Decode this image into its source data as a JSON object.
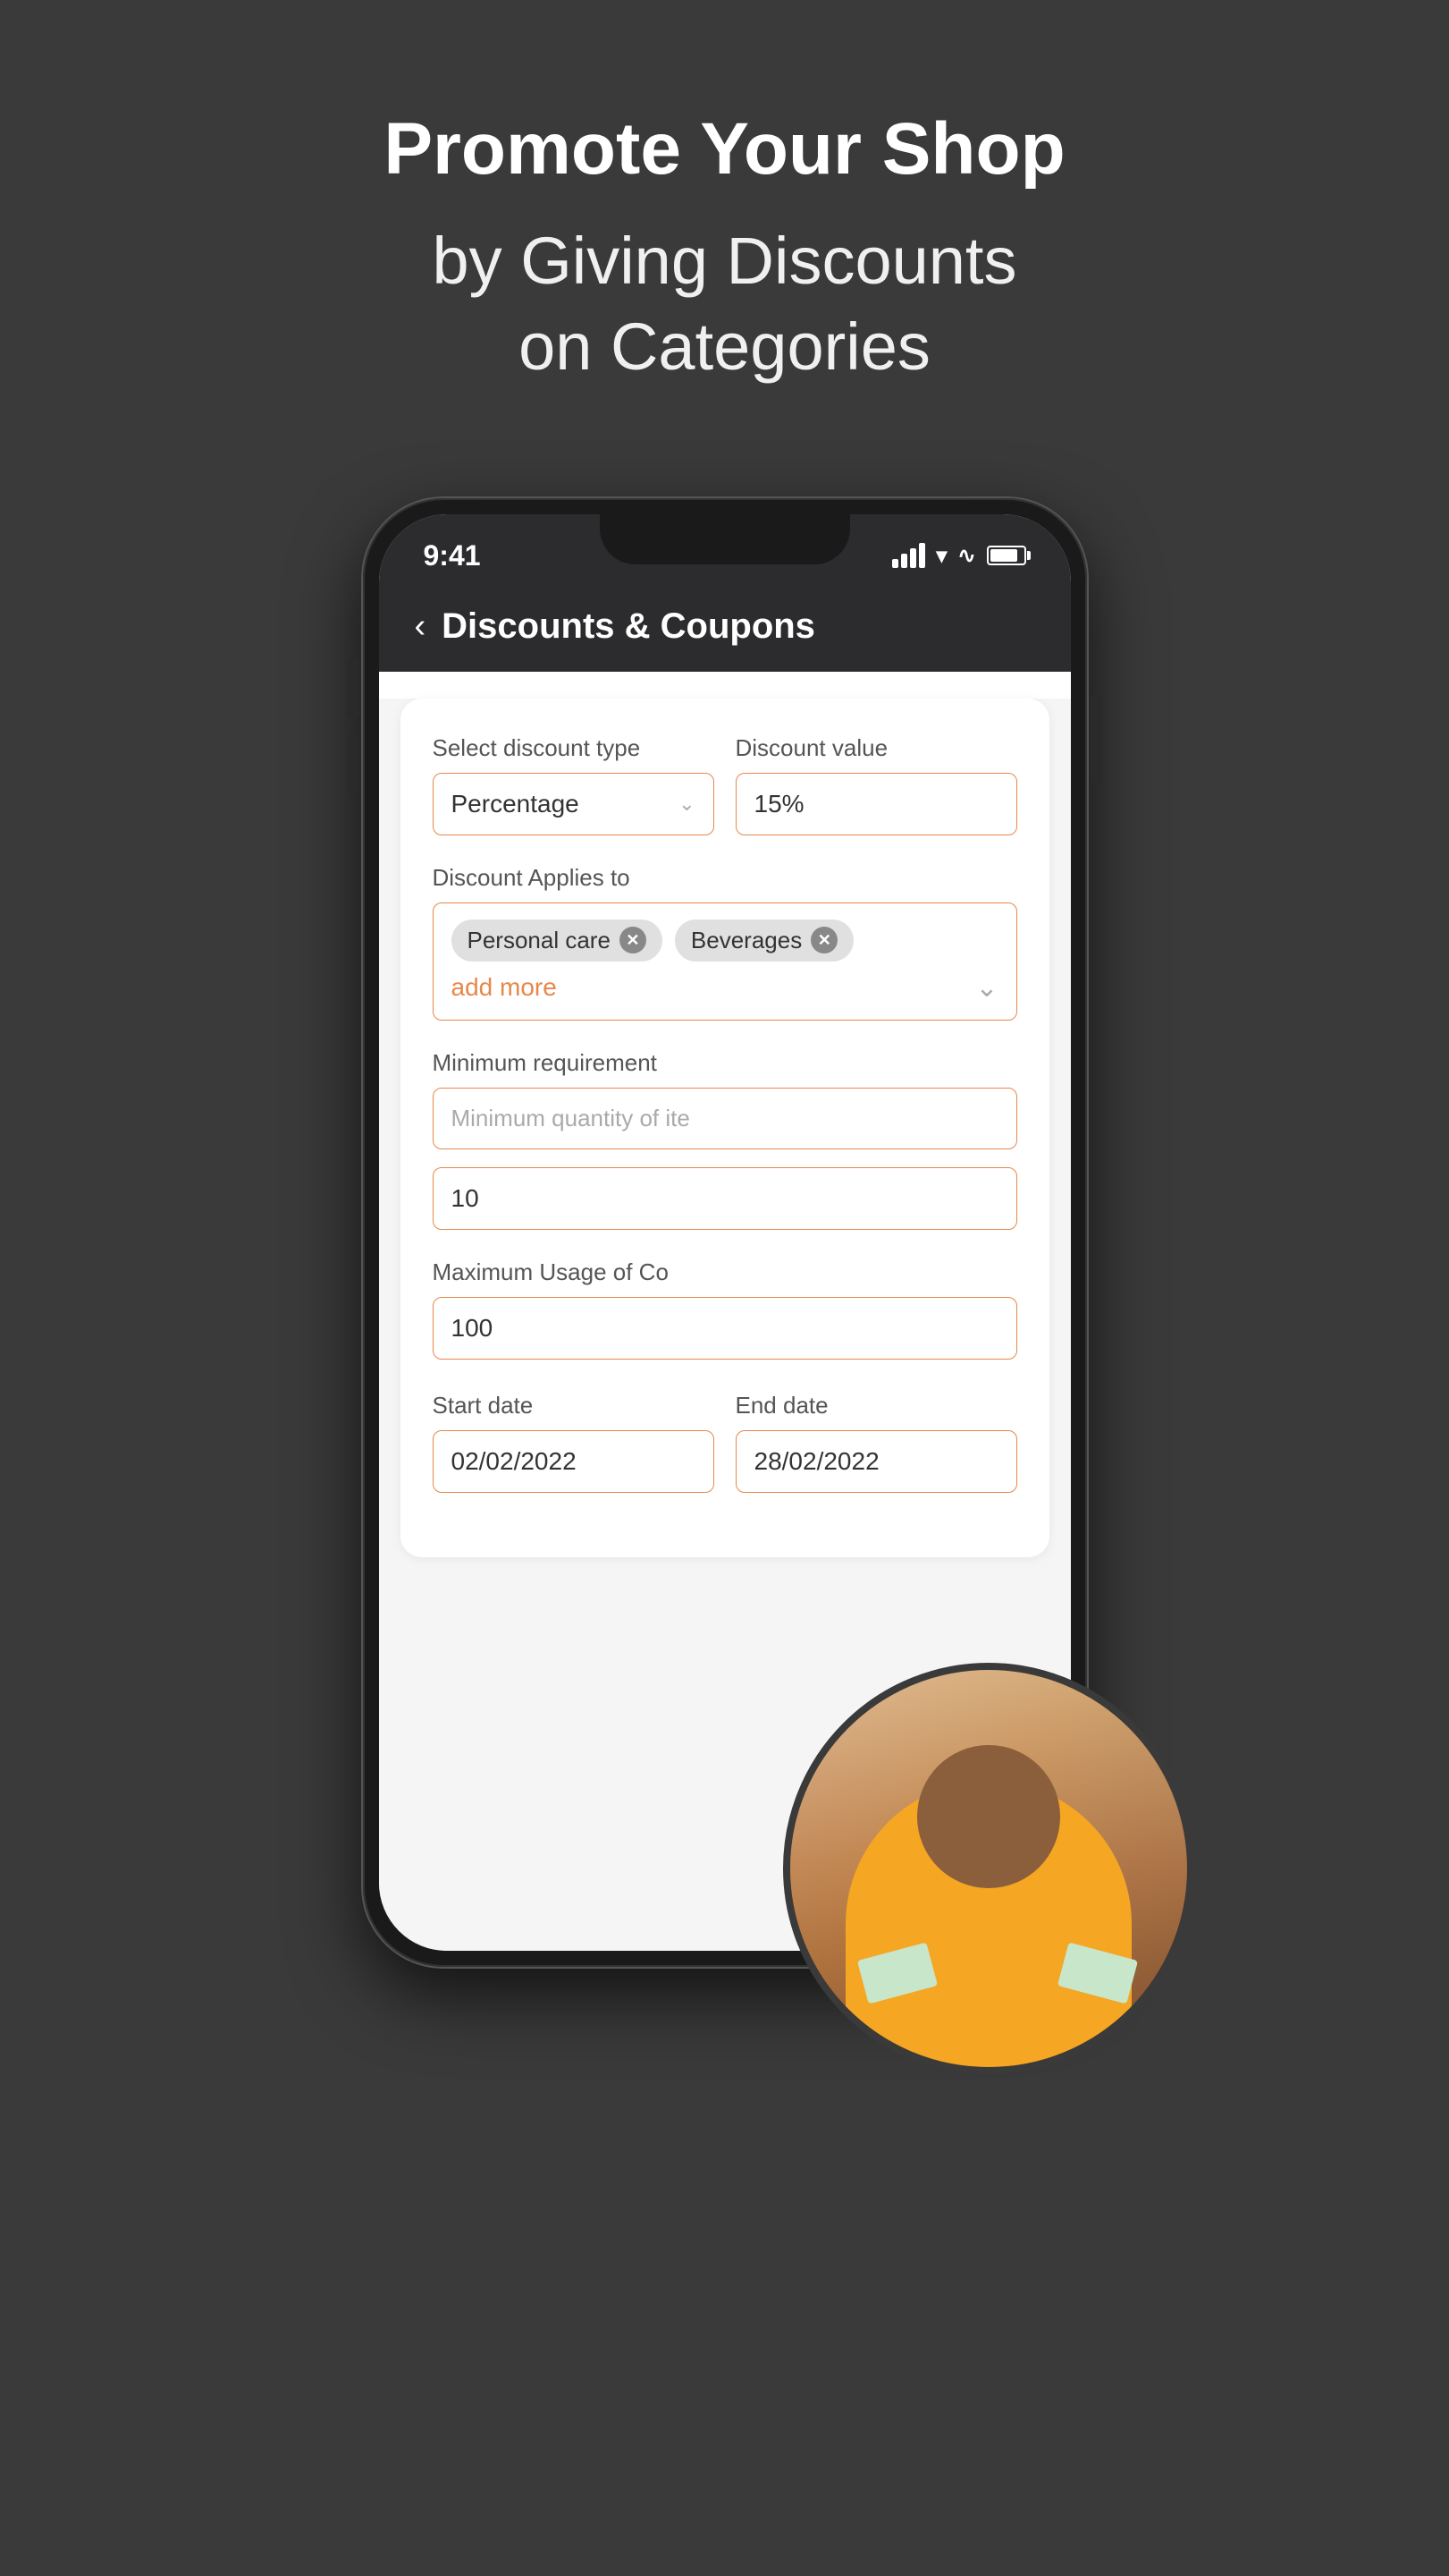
{
  "page": {
    "background_color": "#3a3a3a",
    "title_line1": "Promote Your Shop",
    "title_line2": "by Giving Discounts\non Categories"
  },
  "phone": {
    "status_time": "9:41",
    "nav_title": "Discounts & Coupons",
    "nav_back_label": "‹"
  },
  "form": {
    "discount_type_label": "Select discount type",
    "discount_type_value": "Percentage",
    "discount_value_label": "Discount value",
    "discount_value": "15%",
    "applies_to_label": "Discount Applies to",
    "tags": [
      {
        "name": "Personal care"
      },
      {
        "name": "Beverages"
      }
    ],
    "add_more_label": "add more",
    "minimum_req_label": "Minimum requirement",
    "minimum_req_placeholder": "Minimum quantity of ite",
    "minimum_qty_value": "10",
    "max_usage_label": "Maximum Usage of Co",
    "max_usage_value": "100",
    "start_date_label": "Start date",
    "start_date_value": "02/02/2022",
    "end_date_label": "End date",
    "end_date_value": "28/02/2022"
  }
}
